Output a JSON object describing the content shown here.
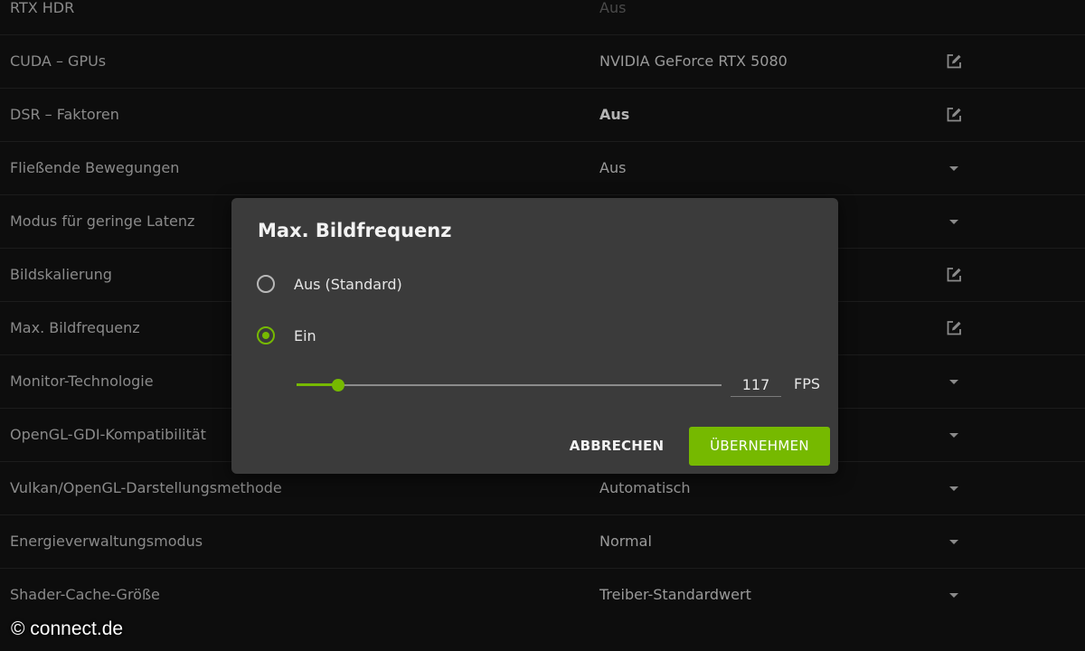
{
  "settings": [
    {
      "label": "RTX HDR",
      "value": "Aus",
      "value_style": "dim",
      "action": "none"
    },
    {
      "label": "CUDA – GPUs",
      "value": "NVIDIA GeForce RTX 5080",
      "value_style": "normal",
      "action": "edit-icon"
    },
    {
      "label": "DSR – Faktoren",
      "value": "Aus",
      "value_style": "bold",
      "action": "edit-icon"
    },
    {
      "label": "Fließende Bewegungen",
      "value": "Aus",
      "value_style": "normal",
      "action": "dropdown-icon"
    },
    {
      "label": "Modus für geringe Latenz",
      "value": "",
      "value_style": "normal",
      "action": "dropdown-icon"
    },
    {
      "label": "Bildskalierung",
      "value": "",
      "value_style": "normal",
      "action": "edit-icon"
    },
    {
      "label": "Max. Bildfrequenz",
      "value": "",
      "value_style": "normal",
      "action": "edit-icon"
    },
    {
      "label": "Monitor-Technologie",
      "value": "",
      "value_style": "normal",
      "action": "dropdown-icon"
    },
    {
      "label": "OpenGL-GDI-Kompatibilität",
      "value": "",
      "value_style": "normal",
      "action": "dropdown-icon"
    },
    {
      "label": "Vulkan/OpenGL-Darstellungsmethode",
      "value": "Automatisch",
      "value_style": "normal",
      "action": "dropdown-icon"
    },
    {
      "label": "Energieverwaltungsmodus",
      "value": "Normal",
      "value_style": "normal",
      "action": "dropdown-icon"
    },
    {
      "label": "Shader-Cache-Größe",
      "value": "Treiber-Standardwert",
      "value_style": "normal",
      "action": "dropdown-icon"
    }
  ],
  "dialog": {
    "title": "Max. Bildfrequenz",
    "options": [
      {
        "label": "Aus (Standard)",
        "selected": false
      },
      {
        "label": "Ein",
        "selected": true
      }
    ],
    "slider_fraction": 0.097,
    "fps_value": "117",
    "fps_unit": "FPS",
    "cancel_label": "ABBRECHEN",
    "apply_label": "ÜBERNEHMEN"
  },
  "watermark": "© connect.de",
  "colors": {
    "accent": "#76b900",
    "background": "#0d0d0d",
    "dialog_background": "#3b3b3b"
  }
}
